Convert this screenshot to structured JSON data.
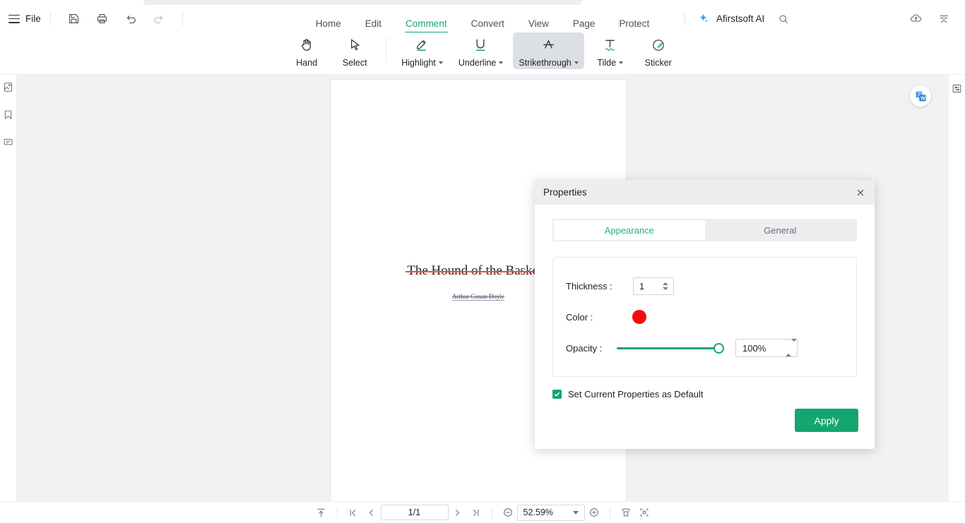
{
  "header": {
    "file_label": "File",
    "menu_icon": "hamburger-icon",
    "quick_icons": [
      "save-icon",
      "print-icon",
      "undo-icon",
      "redo-icon"
    ],
    "ai_label": "Afirstsoft AI",
    "ai_icon": "sparkle-icon",
    "search_icon": "search-icon",
    "cloud_icon": "cloud-upload-icon",
    "collapse_icon": "collapse-ribbon-icon"
  },
  "nav": {
    "items": [
      {
        "label": "Home",
        "active": false
      },
      {
        "label": "Edit",
        "active": false
      },
      {
        "label": "Comment",
        "active": true
      },
      {
        "label": "Convert",
        "active": false
      },
      {
        "label": "View",
        "active": false
      },
      {
        "label": "Page",
        "active": false
      },
      {
        "label": "Protect",
        "active": false
      }
    ]
  },
  "toolbar": {
    "tools": [
      {
        "label": "Hand",
        "icon": "hand-icon",
        "caret": false,
        "selected": false
      },
      {
        "label": "Select",
        "icon": "cursor-icon",
        "caret": false,
        "selected": false
      },
      {
        "label": "Highlight",
        "icon": "highlighter-icon",
        "caret": true,
        "selected": false
      },
      {
        "label": "Underline",
        "icon": "underline-icon",
        "caret": true,
        "selected": false
      },
      {
        "label": "Strikethrough",
        "icon": "strikethrough-icon",
        "caret": true,
        "selected": true
      },
      {
        "label": "Tilde",
        "icon": "tilde-icon",
        "caret": true,
        "selected": false
      },
      {
        "label": "Sticker",
        "icon": "sticker-icon",
        "caret": false,
        "selected": false
      }
    ]
  },
  "left_rail": {
    "items": [
      {
        "icon": "thumbnail-icon"
      },
      {
        "icon": "bookmark-icon"
      },
      {
        "icon": "comment-icon"
      }
    ]
  },
  "right_rail": {
    "items": [
      {
        "icon": "properties-panel-icon"
      }
    ],
    "translate_icon": "word-convert-icon"
  },
  "document": {
    "title": "The Hound of the Baskerv",
    "author": "Arthur Conan Doyle",
    "strike_color": "#e8504b"
  },
  "dialog": {
    "title": "Properties",
    "close_icon": "close-icon",
    "tabs": [
      {
        "label": "Appearance",
        "active": true
      },
      {
        "label": "General",
        "active": false
      }
    ],
    "fields": {
      "thickness_label": "Thickness :",
      "thickness_value": "1",
      "color_label": "Color :",
      "color_value": "#f50d0d",
      "opacity_label": "Opacity :",
      "opacity_value": "100%",
      "opacity_percent": 100
    },
    "default_checkbox": {
      "label": "Set Current Properties as Default",
      "checked": true
    },
    "apply_label": "Apply",
    "accent_color": "#15a571"
  },
  "status_bar": {
    "scroll_top_icon": "scroll-to-top-icon",
    "first_page_icon": "first-page-icon",
    "prev_page_icon": "prev-page-icon",
    "page_value": "1/1",
    "next_page_icon": "next-page-icon",
    "last_page_icon": "last-page-icon",
    "zoom_out_icon": "zoom-out-icon",
    "zoom_value": "52.59%",
    "zoom_in_icon": "zoom-in-icon",
    "fit_page_icon": "fit-page-icon",
    "fit_width_icon": "fit-width-icon"
  }
}
